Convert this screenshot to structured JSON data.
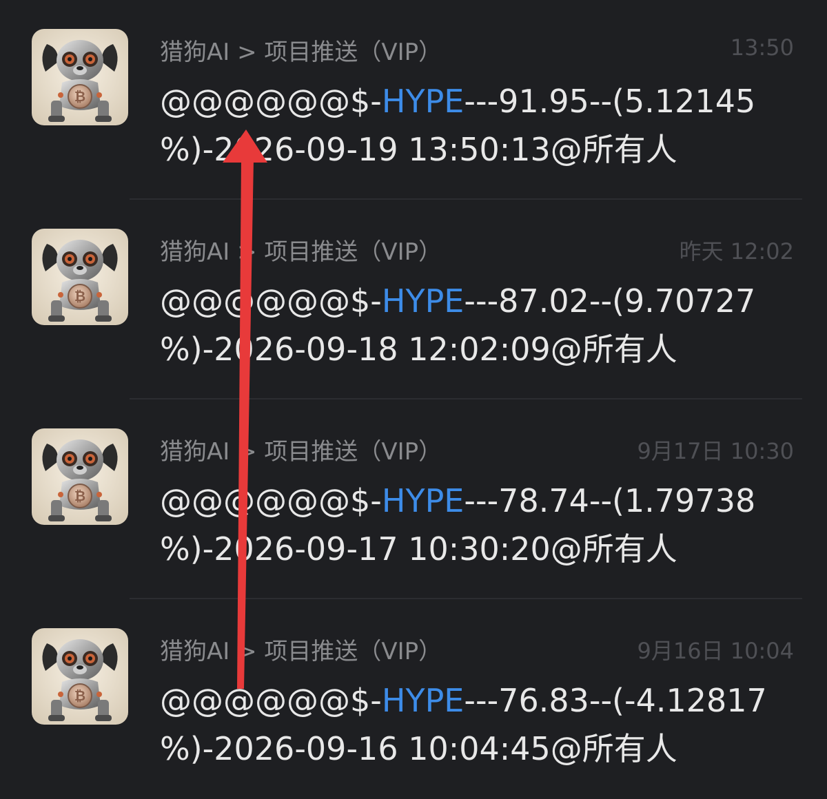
{
  "theme": {
    "background": "#1e1f22",
    "text": "#e8e8e8",
    "secondary": "#8a8b8e",
    "time": "#4f5055",
    "highlight": "#3d8ce8",
    "annotation_arrow": "#e83a3a"
  },
  "messages": [
    {
      "avatar_icon": "robot-dog-bitcoin-avatar-icon",
      "title": "猎狗AI > 项目推送（VIP）",
      "time": "13:50",
      "prefix": "@@@@@@$-",
      "ticker": "HYPE",
      "suffix": "---91.95--(5.12145",
      "line2": "%)-2026-09-19 13:50:13@所有人"
    },
    {
      "avatar_icon": "robot-dog-bitcoin-avatar-icon",
      "title": "猎狗AI > 项目推送（VIP）",
      "time": "昨天 12:02",
      "prefix": "@@@@@@$-",
      "ticker": "HYPE",
      "suffix": "---87.02--(9.70727",
      "line2": "%)-2026-09-18 12:02:09@所有人"
    },
    {
      "avatar_icon": "robot-dog-bitcoin-avatar-icon",
      "title": "猎狗AI > 项目推送（VIP）",
      "time": "9月17日 10:30",
      "prefix": "@@@@@@$-",
      "ticker": "HYPE",
      "suffix": "---78.74--(1.79738",
      "line2": "%)-2026-09-17 10:30:20@所有人"
    },
    {
      "avatar_icon": "robot-dog-bitcoin-avatar-icon",
      "title": "猎狗AI > 项目推送（VIP）",
      "time": "9月16日 10:04",
      "prefix": "@@@@@@$-",
      "ticker": "HYPE",
      "suffix": "---76.83--(-4.12817",
      "line2": "%)-2026-09-16 10:04:45@所有人"
    }
  ]
}
